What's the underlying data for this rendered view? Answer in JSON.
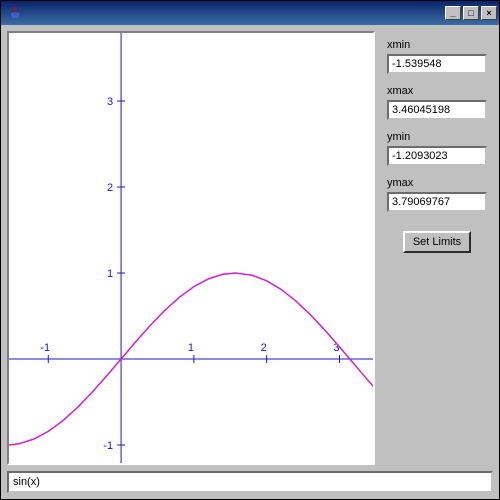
{
  "window": {
    "title": ""
  },
  "sidebar": {
    "xmin_label": "xmin",
    "xmin_value": "-1.539548",
    "xmax_label": "xmax",
    "xmax_value": "3.46045198",
    "ymin_label": "ymin",
    "ymin_value": "-1.2093023",
    "ymax_label": "ymax",
    "ymax_value": "3.79069767",
    "set_limits_label": "Set Limits"
  },
  "expression": {
    "value": "sin(x)"
  },
  "win_btns": {
    "min": "_",
    "max": "□",
    "close": "×"
  },
  "chart_data": {
    "type": "line",
    "title": "",
    "xlabel": "",
    "ylabel": "",
    "xlim": [
      -1.539548,
      3.46045198
    ],
    "ylim": [
      -1.2093023,
      3.79069767
    ],
    "xticks": [
      -1,
      1,
      2,
      3
    ],
    "yticks": [
      -1,
      1,
      2,
      3
    ],
    "series": [
      {
        "name": "sin(x)",
        "color": "#d020d0",
        "x": [
          -1.539548,
          -1.4,
          -1.2,
          -1.0,
          -0.8,
          -0.6,
          -0.4,
          -0.2,
          0.0,
          0.2,
          0.4,
          0.6,
          0.8,
          1.0,
          1.2,
          1.4,
          1.5708,
          1.8,
          2.0,
          2.2,
          2.4,
          2.6,
          2.8,
          3.0,
          3.1416,
          3.3,
          3.46045198
        ],
        "y": [
          -0.9996,
          -0.9854,
          -0.932,
          -0.8415,
          -0.7174,
          -0.5646,
          -0.3894,
          -0.1987,
          0.0,
          0.1987,
          0.3894,
          0.5646,
          0.7174,
          0.8415,
          0.932,
          0.9854,
          1.0,
          0.9738,
          0.9093,
          0.8085,
          0.6755,
          0.5155,
          0.335,
          0.1411,
          0.0,
          -0.1577,
          -0.3161
        ]
      }
    ]
  }
}
